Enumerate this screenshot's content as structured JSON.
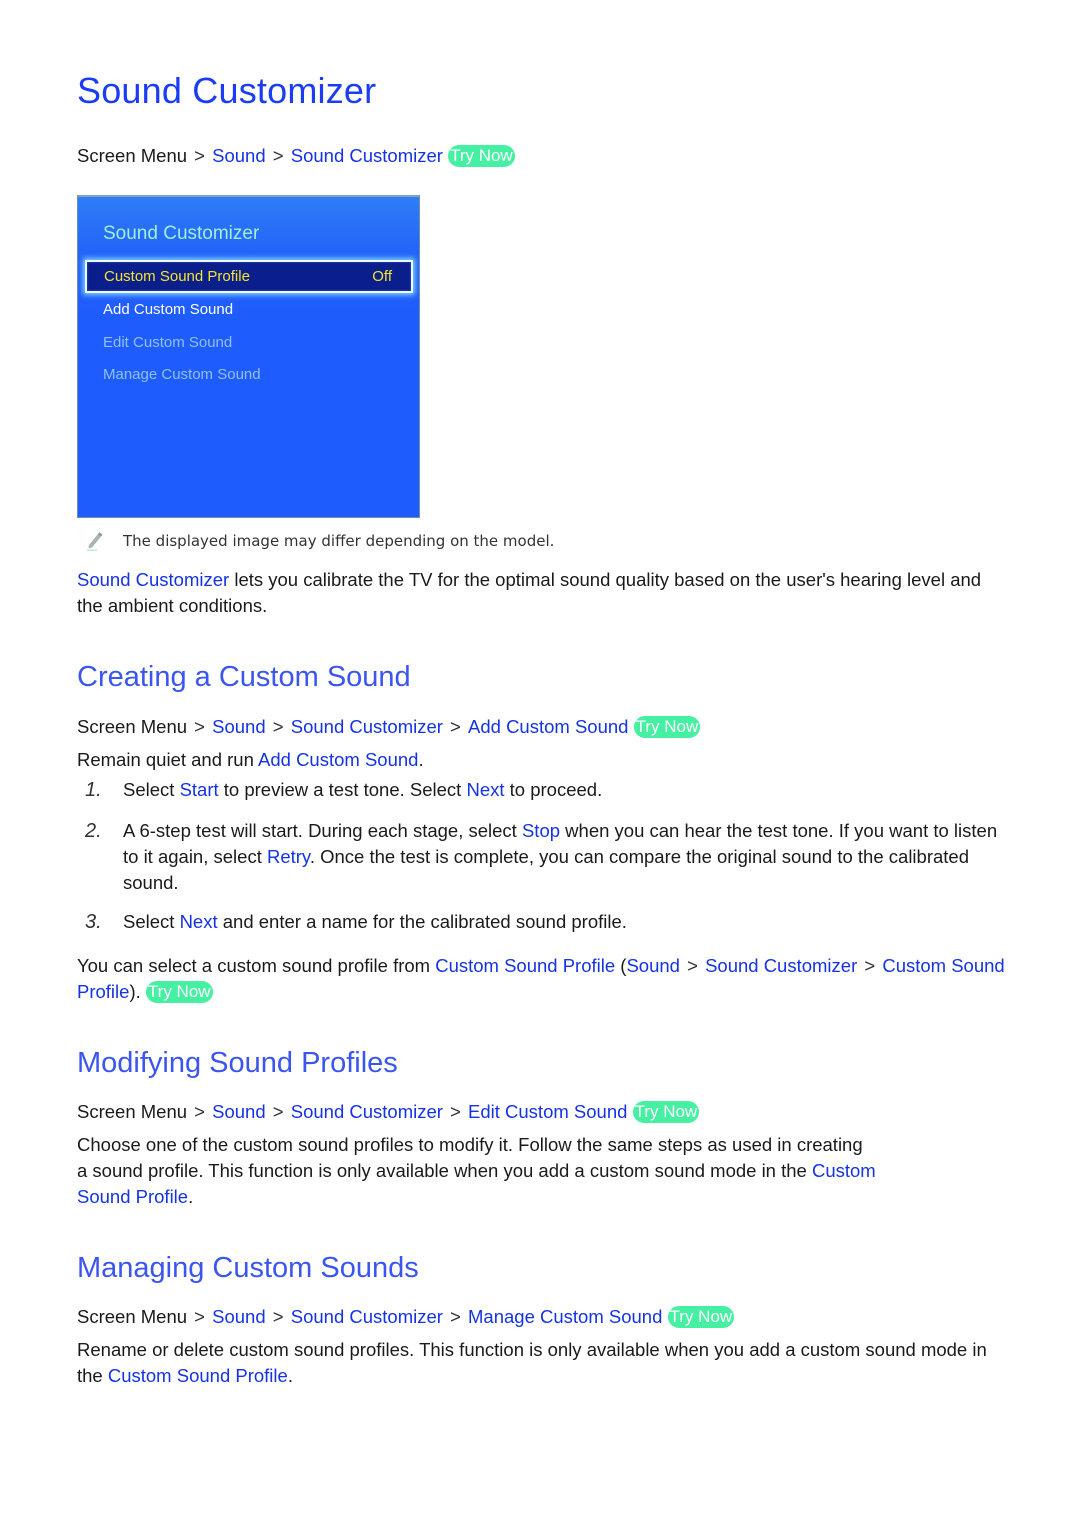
{
  "page": {
    "title": "Sound Customizer",
    "breadcrumb": {
      "root": "Screen Menu",
      "items": [
        "Sound",
        "Sound Customizer"
      ],
      "try_now": "Try Now"
    },
    "menu_screenshot": {
      "title": "Sound Customizer",
      "selected_item": {
        "label": "Custom Sound Profile",
        "value": "Off"
      },
      "items": [
        {
          "label": "Add Custom Sound",
          "state": "enabled"
        },
        {
          "label": "Edit Custom Sound",
          "state": "disabled"
        },
        {
          "label": "Manage Custom Sound",
          "state": "disabled"
        }
      ]
    },
    "note": {
      "icon": "pencil-icon",
      "text": "The displayed image may differ depending on the model."
    },
    "intro": {
      "link": "Sound Customizer",
      "text": " lets you calibrate the TV for the optimal sound quality based on the user's hearing level and the ambient conditions."
    }
  },
  "sections": {
    "creating": {
      "heading": "Creating a Custom Sound",
      "breadcrumb": {
        "root": "Screen Menu",
        "items": [
          "Sound",
          "Sound Customizer",
          "Add Custom Sound"
        ],
        "try_now": "Try Now"
      },
      "lead": {
        "text": "Remain quiet and run ",
        "link": "Add Custom Sound",
        "end": "."
      },
      "steps": [
        {
          "num": "1.",
          "p1": "Select ",
          "l1": "Start",
          "p2": " to preview a test tone. Select ",
          "l2": "Next",
          "p3": " to proceed."
        },
        {
          "num": "2.",
          "p1": "A 6-step test will start. During each stage, select ",
          "l1": "Stop",
          "p2": " when you can hear the test tone. If you want to listen to it again, select ",
          "l2": "Retry",
          "p3": ". Once the test is complete, you can compare the original sound to the calibrated sound."
        },
        {
          "num": "3.",
          "p1": "Select ",
          "l1": "Next",
          "p2": " and enter a name for the calibrated sound profile."
        }
      ],
      "followup": {
        "p1": "You can select a custom sound profile from ",
        "l1": "Custom Sound Profile",
        "p2": " (",
        "l2": "Sound",
        "l3": "Sound Customizer",
        "l4": "Custom Sound Profile",
        "p3": ").",
        "try_now": "Try Now"
      }
    },
    "modifying": {
      "heading": "Modifying Sound Profiles",
      "breadcrumb": {
        "root": "Screen Menu",
        "items": [
          "Sound",
          "Sound Customizer",
          "Edit Custom Sound"
        ],
        "try_now": "Try Now"
      },
      "line1": "Choose one of the custom sound profiles to modify it. Follow the same steps as used in creating",
      "line2": "a sound profile. This function is only available when you add a custom sound mode in the ",
      "link_a": "Custom",
      "link_b": "Sound Profile",
      "end": "."
    },
    "managing": {
      "heading": "Managing Custom Sounds",
      "breadcrumb": {
        "root": "Screen Menu",
        "items": [
          "Sound",
          "Sound Customizer",
          "Manage Custom Sound"
        ],
        "try_now": "Try Now"
      },
      "text": "Rename or delete custom sound profiles. This function is only available when you add a custom sound mode in the ",
      "link": "Custom Sound Profile",
      "end": "."
    }
  },
  "colors": {
    "heading": "#1a3cf5",
    "link": "#1432e6",
    "try_now_bg": "#46f0a2",
    "menu_bg": "#1f5cfd",
    "menu_selected_bg": "#0a1e8c",
    "menu_selected_text": "#f3e62b"
  }
}
